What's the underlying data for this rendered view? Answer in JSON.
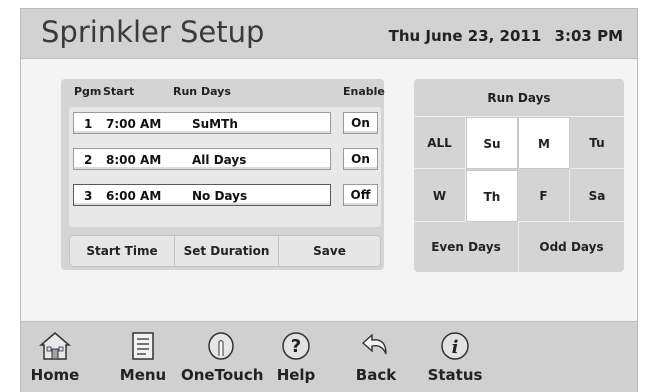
{
  "header": {
    "title": "Sprinkler Setup",
    "date": "Thu June 23, 2011",
    "time": "3:03 PM"
  },
  "programs": {
    "columns": {
      "pgm": "Pgm",
      "start": "Start",
      "run_days": "Run Days",
      "enable": "Enable"
    },
    "rows": [
      {
        "num": "1",
        "start": "7:00 AM",
        "days": "SuMTh",
        "enable": "On",
        "selected": false
      },
      {
        "num": "2",
        "start": "8:00 AM",
        "days": "All Days",
        "enable": "On",
        "selected": false
      },
      {
        "num": "3",
        "start": "6:00 AM",
        "days": "No Days",
        "enable": "Off",
        "selected": true
      }
    ],
    "actions": {
      "start_time": "Start Time",
      "set_duration": "Set Duration",
      "save": "Save"
    }
  },
  "run_days": {
    "title": "Run Days",
    "cells": [
      {
        "label": "ALL",
        "on": false
      },
      {
        "label": "Su",
        "on": true
      },
      {
        "label": "M",
        "on": true
      },
      {
        "label": "Tu",
        "on": false
      },
      {
        "label": "W",
        "on": false
      },
      {
        "label": "Th",
        "on": true
      },
      {
        "label": "F",
        "on": false
      },
      {
        "label": "Sa",
        "on": false
      }
    ],
    "even": "Even Days",
    "odd": "Odd Days"
  },
  "nav": {
    "home": "Home",
    "menu": "Menu",
    "onetouch": "OneTouch",
    "help": "Help",
    "back": "Back",
    "status": "Status"
  },
  "colors": {
    "panel": "#d4d4d4",
    "selected_day": "#ffffff",
    "background": "#f4f4f4"
  }
}
